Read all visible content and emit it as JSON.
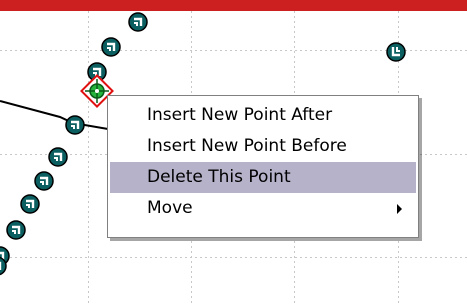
{
  "header": {
    "accent_color": "#cc1f1f"
  },
  "plot": {
    "grid_color": "#c8c8c8",
    "point_fill_color": "#0b5f60",
    "selected_point_colors": [
      "#e01010",
      "#24b43c"
    ],
    "point_icon": "grid-control-point-icon",
    "selected_point_icon": "selected-point-target-icon"
  },
  "context_menu": {
    "items": [
      {
        "label": "Insert New Point After"
      },
      {
        "label": "Insert New Point Before"
      },
      {
        "label": "Delete This Point",
        "highlighted": true
      },
      {
        "label": "Move",
        "has_submenu": true
      }
    ],
    "highlight_color": "#b5b2c9",
    "submenu_icon": "chevron-right-icon"
  }
}
